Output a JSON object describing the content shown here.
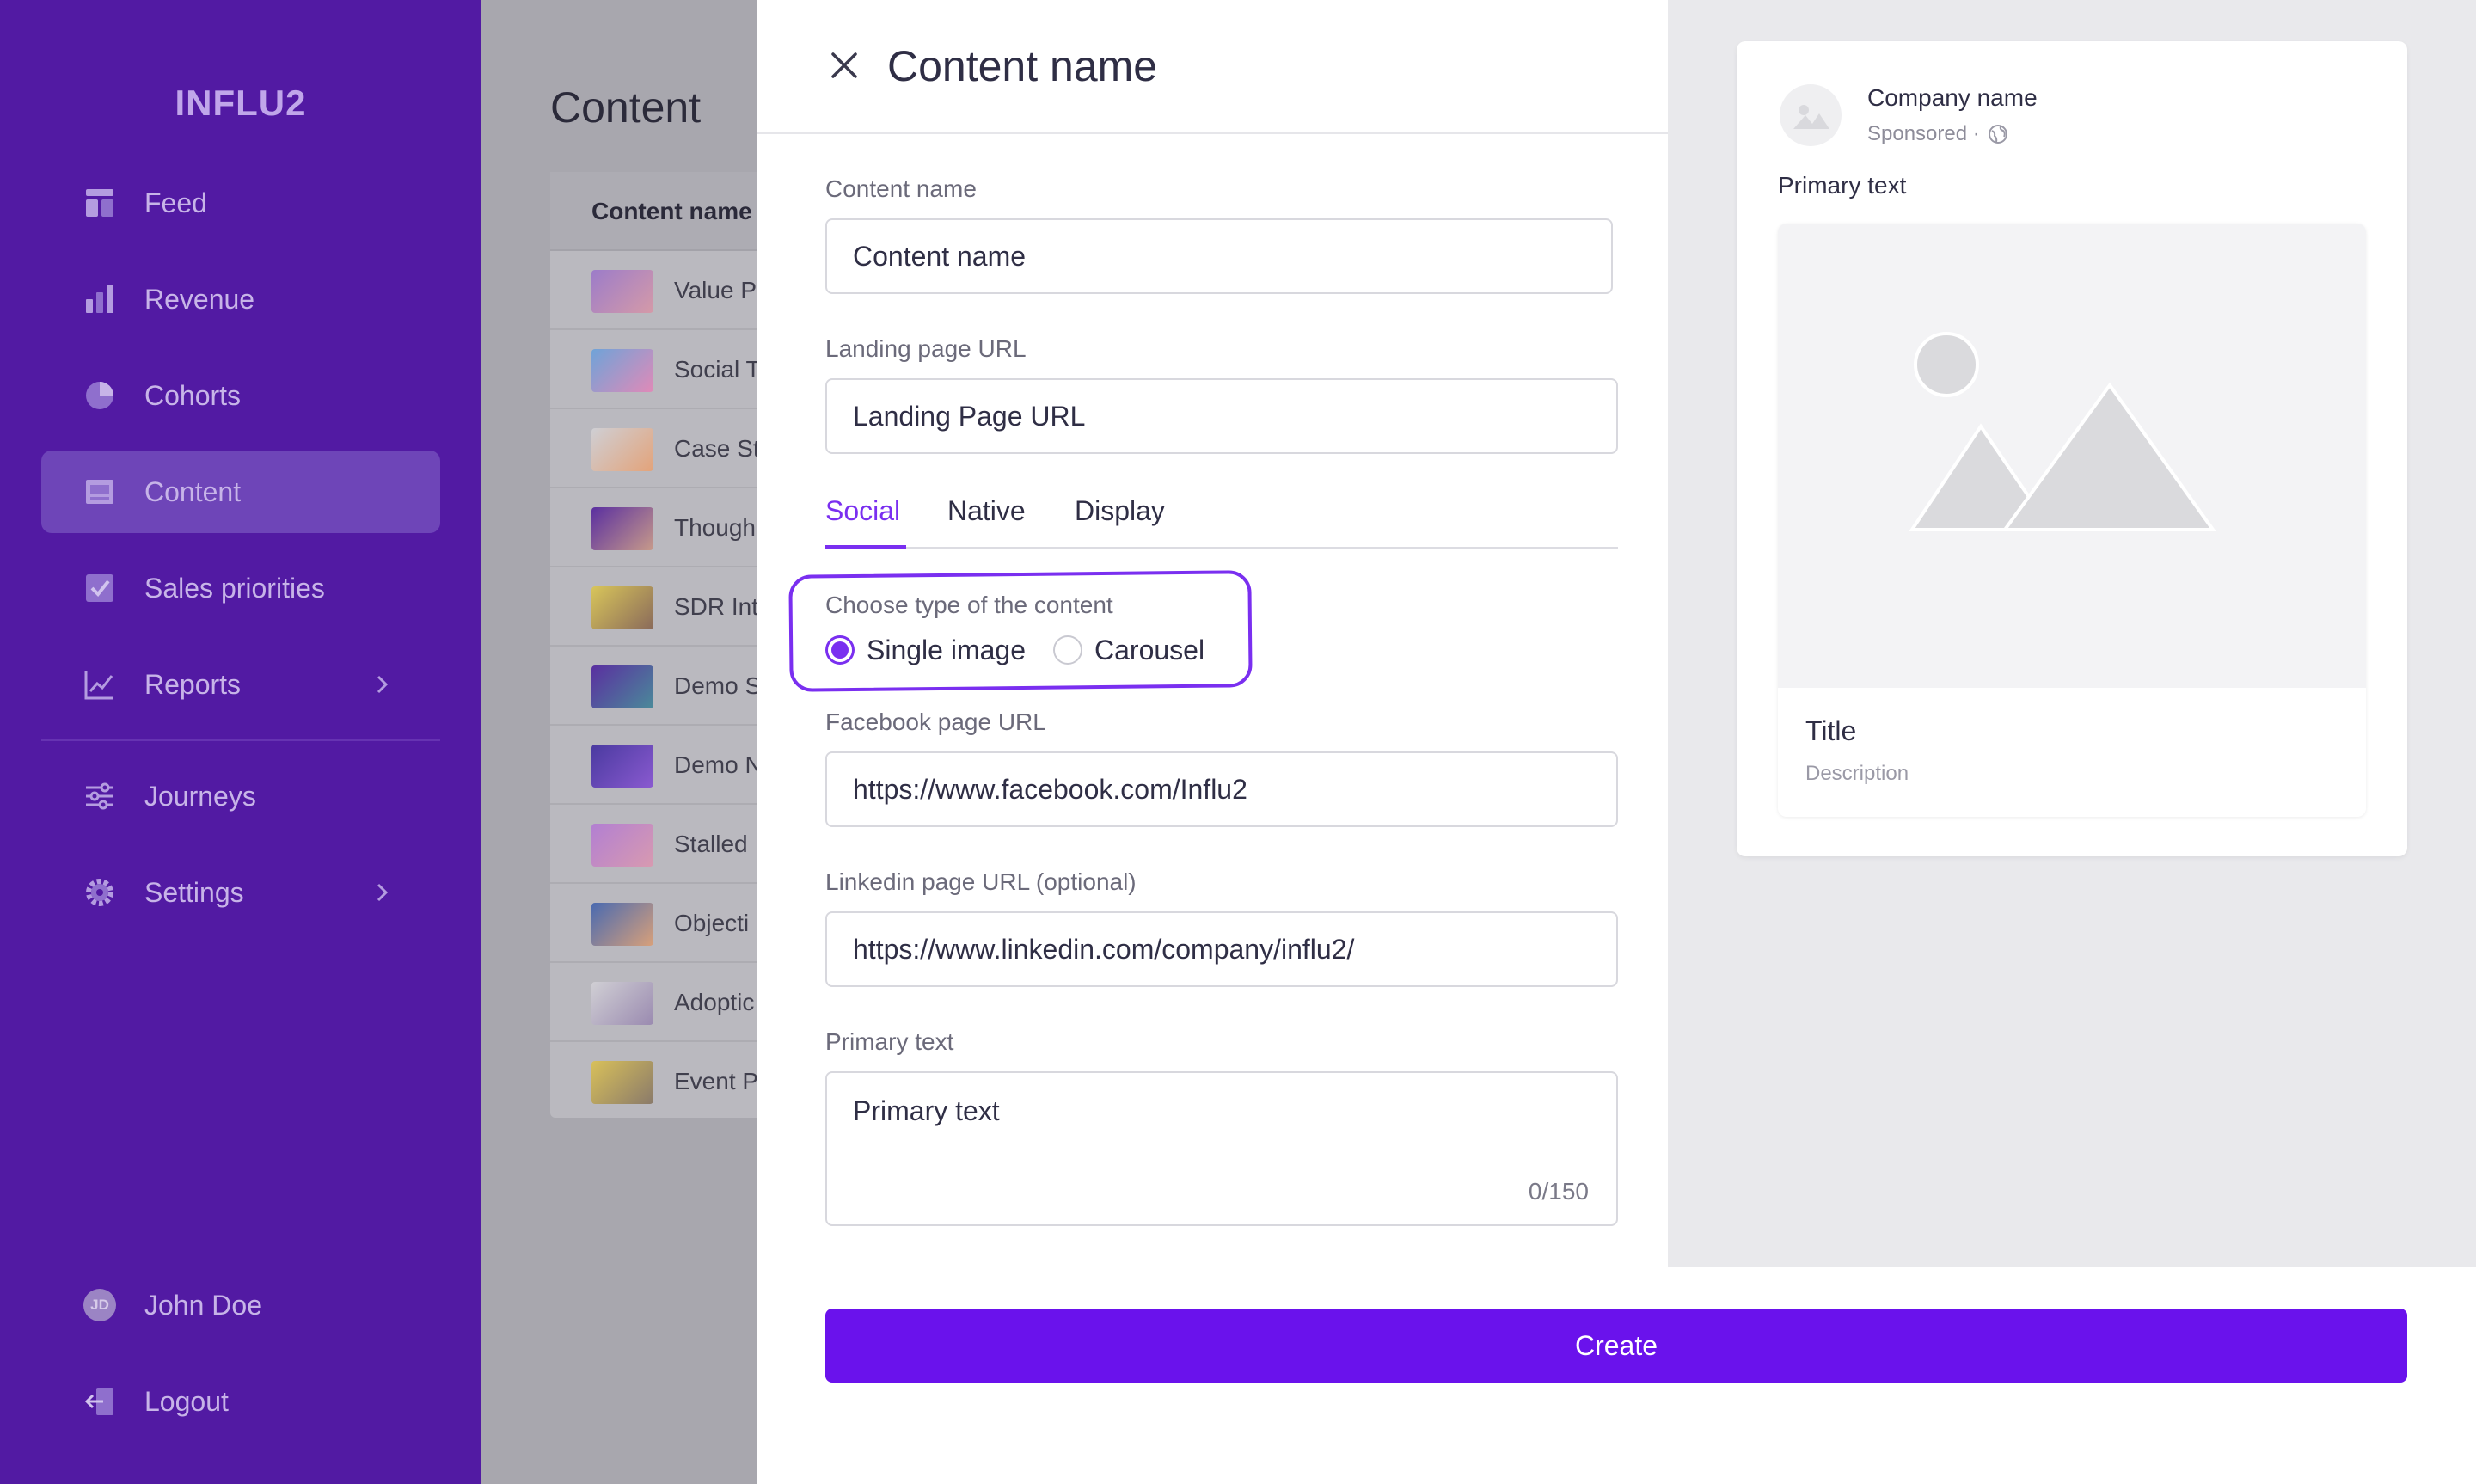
{
  "sidebar": {
    "logo": "INFLU2",
    "items": [
      {
        "label": "Feed",
        "icon": "feed-icon"
      },
      {
        "label": "Revenue",
        "icon": "bar-chart-icon"
      },
      {
        "label": "Cohorts",
        "icon": "pie-chart-icon"
      },
      {
        "label": "Content",
        "icon": "content-icon",
        "active": true
      },
      {
        "label": "Sales priorities",
        "icon": "checkbox-icon"
      },
      {
        "label": "Reports",
        "icon": "line-chart-icon"
      },
      {
        "label": "Journeys",
        "icon": "sliders-icon"
      },
      {
        "label": "Settings",
        "icon": "gear-icon"
      }
    ],
    "user": {
      "initials": "JD",
      "name": "John Doe"
    },
    "logout": "Logout"
  },
  "background_page": {
    "title": "Content",
    "table_header": "Content name",
    "rows": [
      "Value P",
      "Social T",
      "Case St",
      "Though",
      "SDR Int",
      "Demo S",
      "Demo N",
      "Stalled",
      "Objecti",
      "Adoptic",
      "Event P"
    ]
  },
  "drawer": {
    "title": "Content name",
    "fields": {
      "content_name": {
        "label": "Content name",
        "value": "Content name"
      },
      "landing_url": {
        "label": "Landing page URL",
        "value": "Landing Page URL"
      },
      "facebook_url": {
        "label": "Facebook page URL",
        "value": "https://www.facebook.com/Influ2"
      },
      "linkedin_url": {
        "label": "Linkedin page URL (optional)",
        "value": "https://www.linkedin.com/company/influ2/"
      },
      "primary_text": {
        "label": "Primary text",
        "value": "Primary text",
        "counter": "0/150"
      }
    },
    "tabs": [
      {
        "label": "Social",
        "active": true
      },
      {
        "label": "Native"
      },
      {
        "label": "Display"
      }
    ],
    "content_type": {
      "label": "Choose type of the content",
      "options": [
        {
          "label": "Single image",
          "selected": true
        },
        {
          "label": "Carousel",
          "selected": false
        }
      ]
    },
    "create_button": "Create"
  },
  "preview": {
    "company": "Company name",
    "sponsored": "Sponsored ·",
    "primary_text": "Primary text",
    "title": "Title",
    "description": "Description"
  },
  "colors": {
    "sidebar_bg": "#521aa3",
    "sidebar_active": "#6e45b8",
    "accent": "#7a2ff0",
    "create_button": "#6a12ec",
    "overlay": "#a8a7ae",
    "preview_bg": "#e9e9ec"
  }
}
